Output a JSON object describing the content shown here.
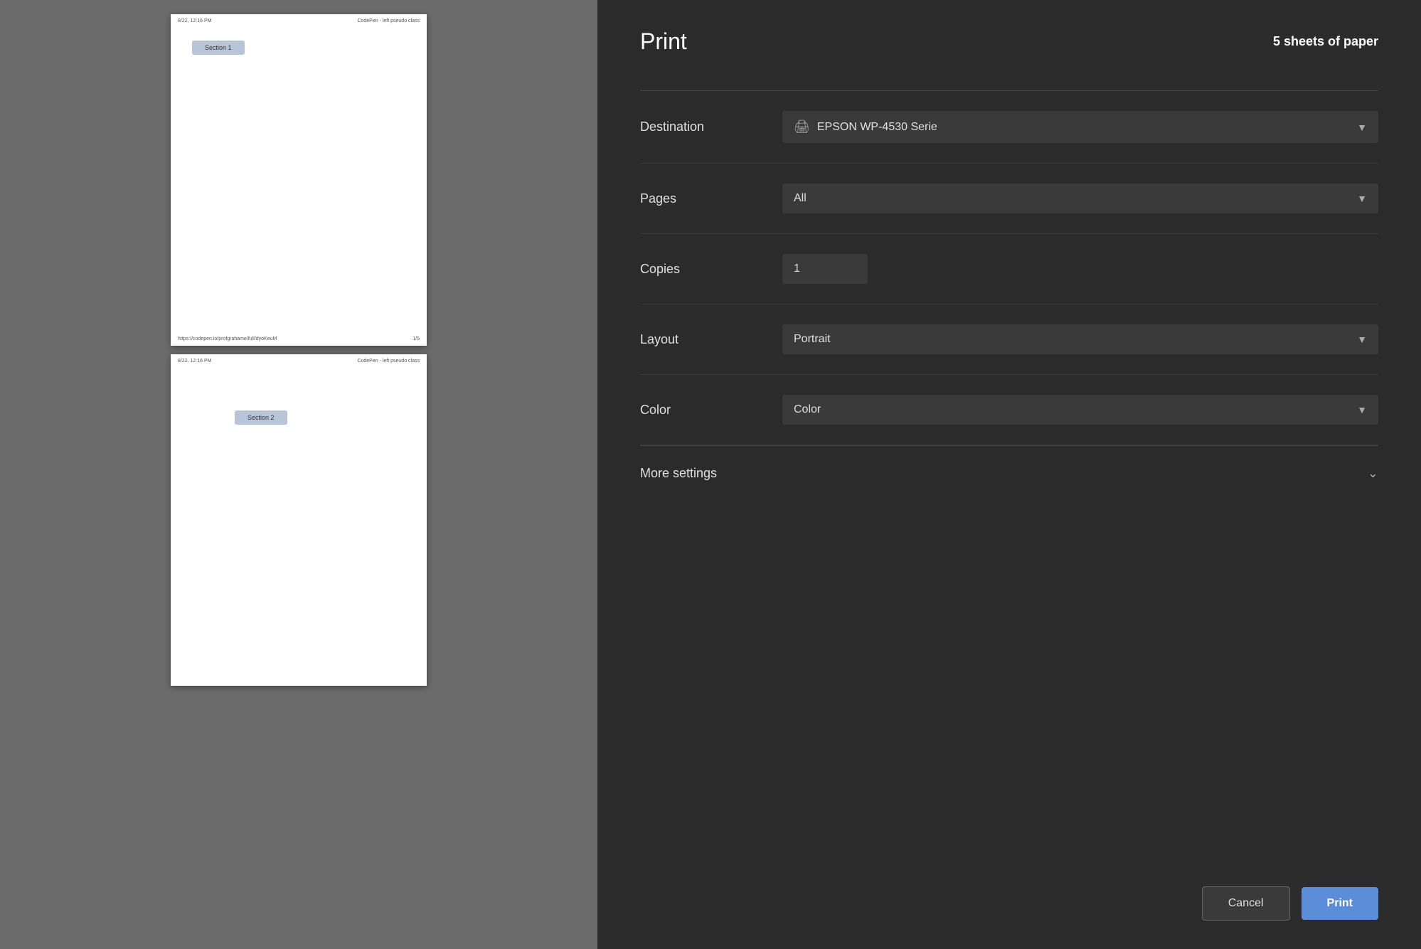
{
  "preview": {
    "page1": {
      "timestamp": "8/22, 12:16 PM",
      "title": "CodePen - left pseudo class",
      "section_label": "Section 1",
      "url": "https://codepen.io/profgrahame/full/dyoKeuM",
      "page_num": "1/5"
    },
    "page2": {
      "timestamp": "8/22, 12:16 PM",
      "title": "CodePen - left pseudo class",
      "section_label": "Section 2",
      "url": "",
      "page_num": ""
    }
  },
  "print_panel": {
    "title": "Print",
    "sheets_info": "5 sheets of paper",
    "destination_label": "Destination",
    "destination_value": "EPSON WP-4530 Serie",
    "pages_label": "Pages",
    "pages_value": "All",
    "copies_label": "Copies",
    "copies_value": "1",
    "layout_label": "Layout",
    "layout_value": "Portrait",
    "color_label": "Color",
    "color_value": "Color",
    "more_settings_label": "More settings",
    "cancel_label": "Cancel",
    "print_label": "Print"
  }
}
